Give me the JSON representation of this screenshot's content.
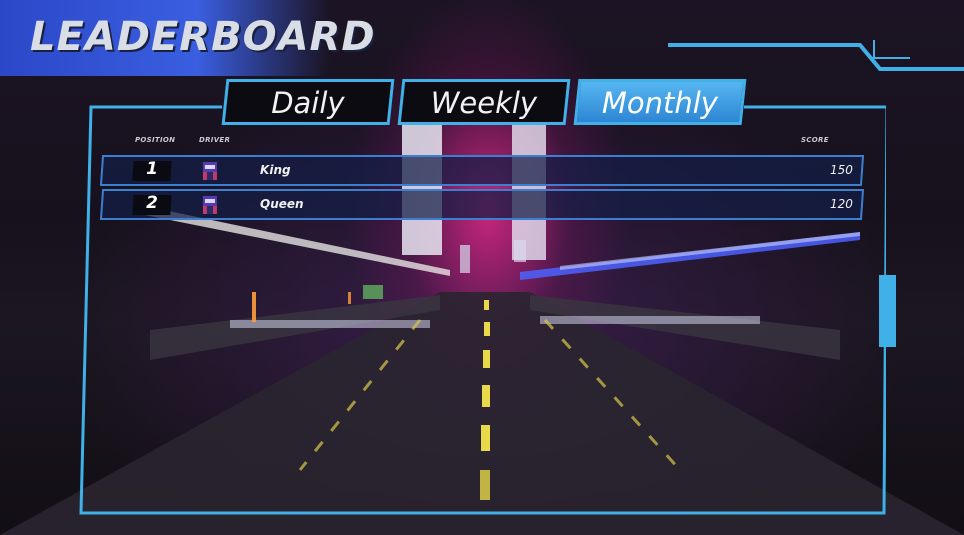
{
  "header": {
    "title": "LEADERBOARD"
  },
  "tabs": [
    {
      "label": "Daily",
      "active": false
    },
    {
      "label": "Weekly",
      "active": false
    },
    {
      "label": "Monthly",
      "active": true
    }
  ],
  "table": {
    "columns": {
      "position": "POSITION",
      "driver": "DRIVER",
      "score": "SCORE"
    },
    "rows": [
      {
        "position": "1",
        "driver": "King",
        "score": "150",
        "avatar": "racer-helmet-icon"
      },
      {
        "position": "2",
        "driver": "Queen",
        "score": "120",
        "avatar": "racer-helmet-icon"
      }
    ]
  },
  "colors": {
    "accent": "#3fb0e8",
    "title_bar": "#2b48c8",
    "active_tab": "#4aa8ec",
    "row_border": "#3c7fd0"
  }
}
